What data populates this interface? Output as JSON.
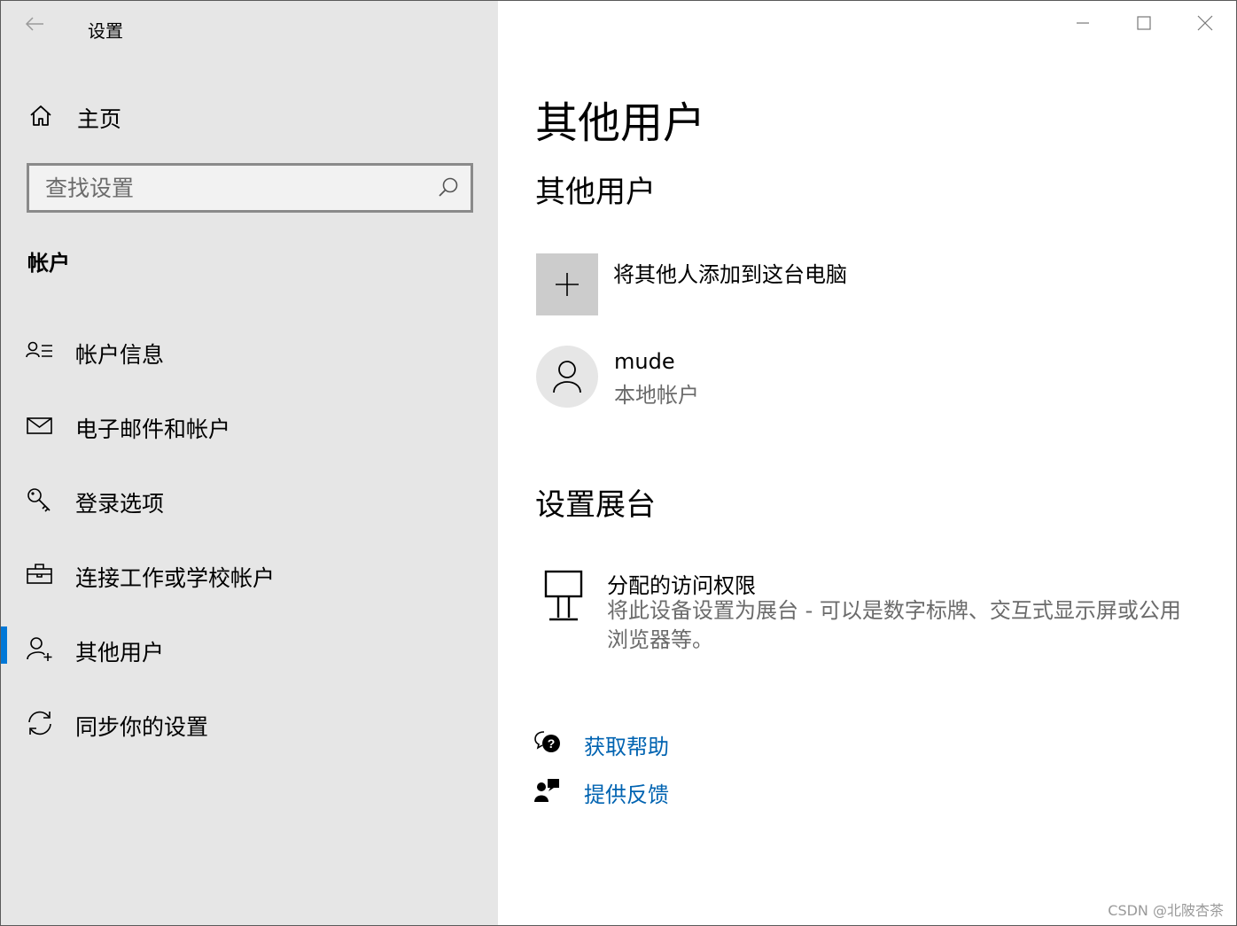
{
  "window": {
    "app_title": "设置",
    "controls": [
      "minimize",
      "maximize",
      "close"
    ]
  },
  "sidebar": {
    "home_label": "主页",
    "search": {
      "placeholder": "查找设置",
      "value": ""
    },
    "section_title": "帐户",
    "items": [
      {
        "label": "帐户信息",
        "icon": "account-info-icon",
        "active": false
      },
      {
        "label": "电子邮件和帐户",
        "icon": "mail-icon",
        "active": false
      },
      {
        "label": "登录选项",
        "icon": "key-icon",
        "active": false
      },
      {
        "label": "连接工作或学校帐户",
        "icon": "briefcase-icon",
        "active": false
      },
      {
        "label": "其他用户",
        "icon": "add-person-icon",
        "active": true
      },
      {
        "label": "同步你的设置",
        "icon": "sync-icon",
        "active": false
      }
    ]
  },
  "main": {
    "page_title": "其他用户",
    "other_users": {
      "heading": "其他用户",
      "add_label": "将其他人添加到这台电脑",
      "users": [
        {
          "name": "mude",
          "type": "本地帐户"
        }
      ]
    },
    "kiosk": {
      "heading": "设置展台",
      "title": "分配的访问权限",
      "description": "将此设备设置为展台 - 可以是数字标牌、交互式显示屏或公用浏览器等。"
    },
    "links": {
      "help": "获取帮助",
      "feedback": "提供反馈"
    }
  },
  "watermark": "CSDN @北陂杏茶",
  "colors": {
    "sidebar_bg": "#e6e6e6",
    "accent": "#0078d7",
    "link": "#0063b1",
    "secondary_text": "#6b6b6b"
  }
}
